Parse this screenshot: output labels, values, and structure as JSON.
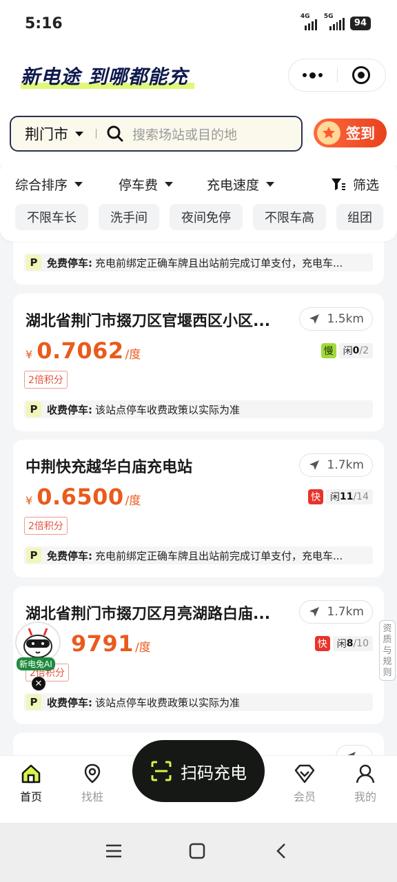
{
  "status": {
    "time": "5:16",
    "net1": "4G",
    "net2": "5G",
    "battery": "94"
  },
  "header": {
    "slogan": "新电途 到哪都能充"
  },
  "search": {
    "city": "荆门市",
    "placeholder": "搜索场站或目的地",
    "checkin_label": "签到"
  },
  "filters": {
    "sort": [
      "综合排序",
      "停车费",
      "充电速度"
    ],
    "screen_label": "筛选",
    "tags": [
      "不限车长",
      "洗手间",
      "夜间免停",
      "不限车高",
      "组团"
    ]
  },
  "stations": [
    {
      "parking_type": "免费停车:",
      "parking_note": "充电前绑定正确车牌且出站前完成订单支付，充电车..."
    },
    {
      "name": "湖北省荆门市掇刀区官堰西区小区...",
      "distance": "1.5km",
      "price": "0.7062",
      "unit": "/度",
      "speed_badge": "慢",
      "idle_label": "闲",
      "idle": "0",
      "total": "/2",
      "points": "2倍积分",
      "parking_type": "收费停车:",
      "parking_note": "该站点停车收费政策以实际为准"
    },
    {
      "name": "中荆快充越华白庙充电站",
      "distance": "1.7km",
      "price": "0.6500",
      "unit": "/度",
      "speed_badge": "快",
      "idle_label": "闲",
      "idle": "11",
      "total": "/14",
      "points": "2倍积分",
      "parking_type": "免费停车:",
      "parking_note": "充电前绑定正确车牌且出站前完成订单支付，充电车..."
    },
    {
      "name": "湖北省荆门市掇刀区月亮湖路白庙...",
      "distance": "1.7km",
      "price": "9791",
      "unit": "/度",
      "speed_badge": "快",
      "idle_label": "闲",
      "idle": "8",
      "total": "/10",
      "points": "2倍积分",
      "parking_type": "收费停车:",
      "parking_note": "该站点停车收费政策以实际为准"
    }
  ],
  "currency": "¥",
  "side_pill": "资质与规则",
  "ai_bot": {
    "label": "新电兔AI"
  },
  "scan": {
    "label": "扫码充电"
  },
  "nav": {
    "home": "首页",
    "find": "找桩",
    "member": "会员",
    "mine": "我的"
  },
  "colors": {
    "accent": "#e95b1c",
    "brand_dark": "#0f1a4d",
    "highlight": "#d6f54a"
  }
}
